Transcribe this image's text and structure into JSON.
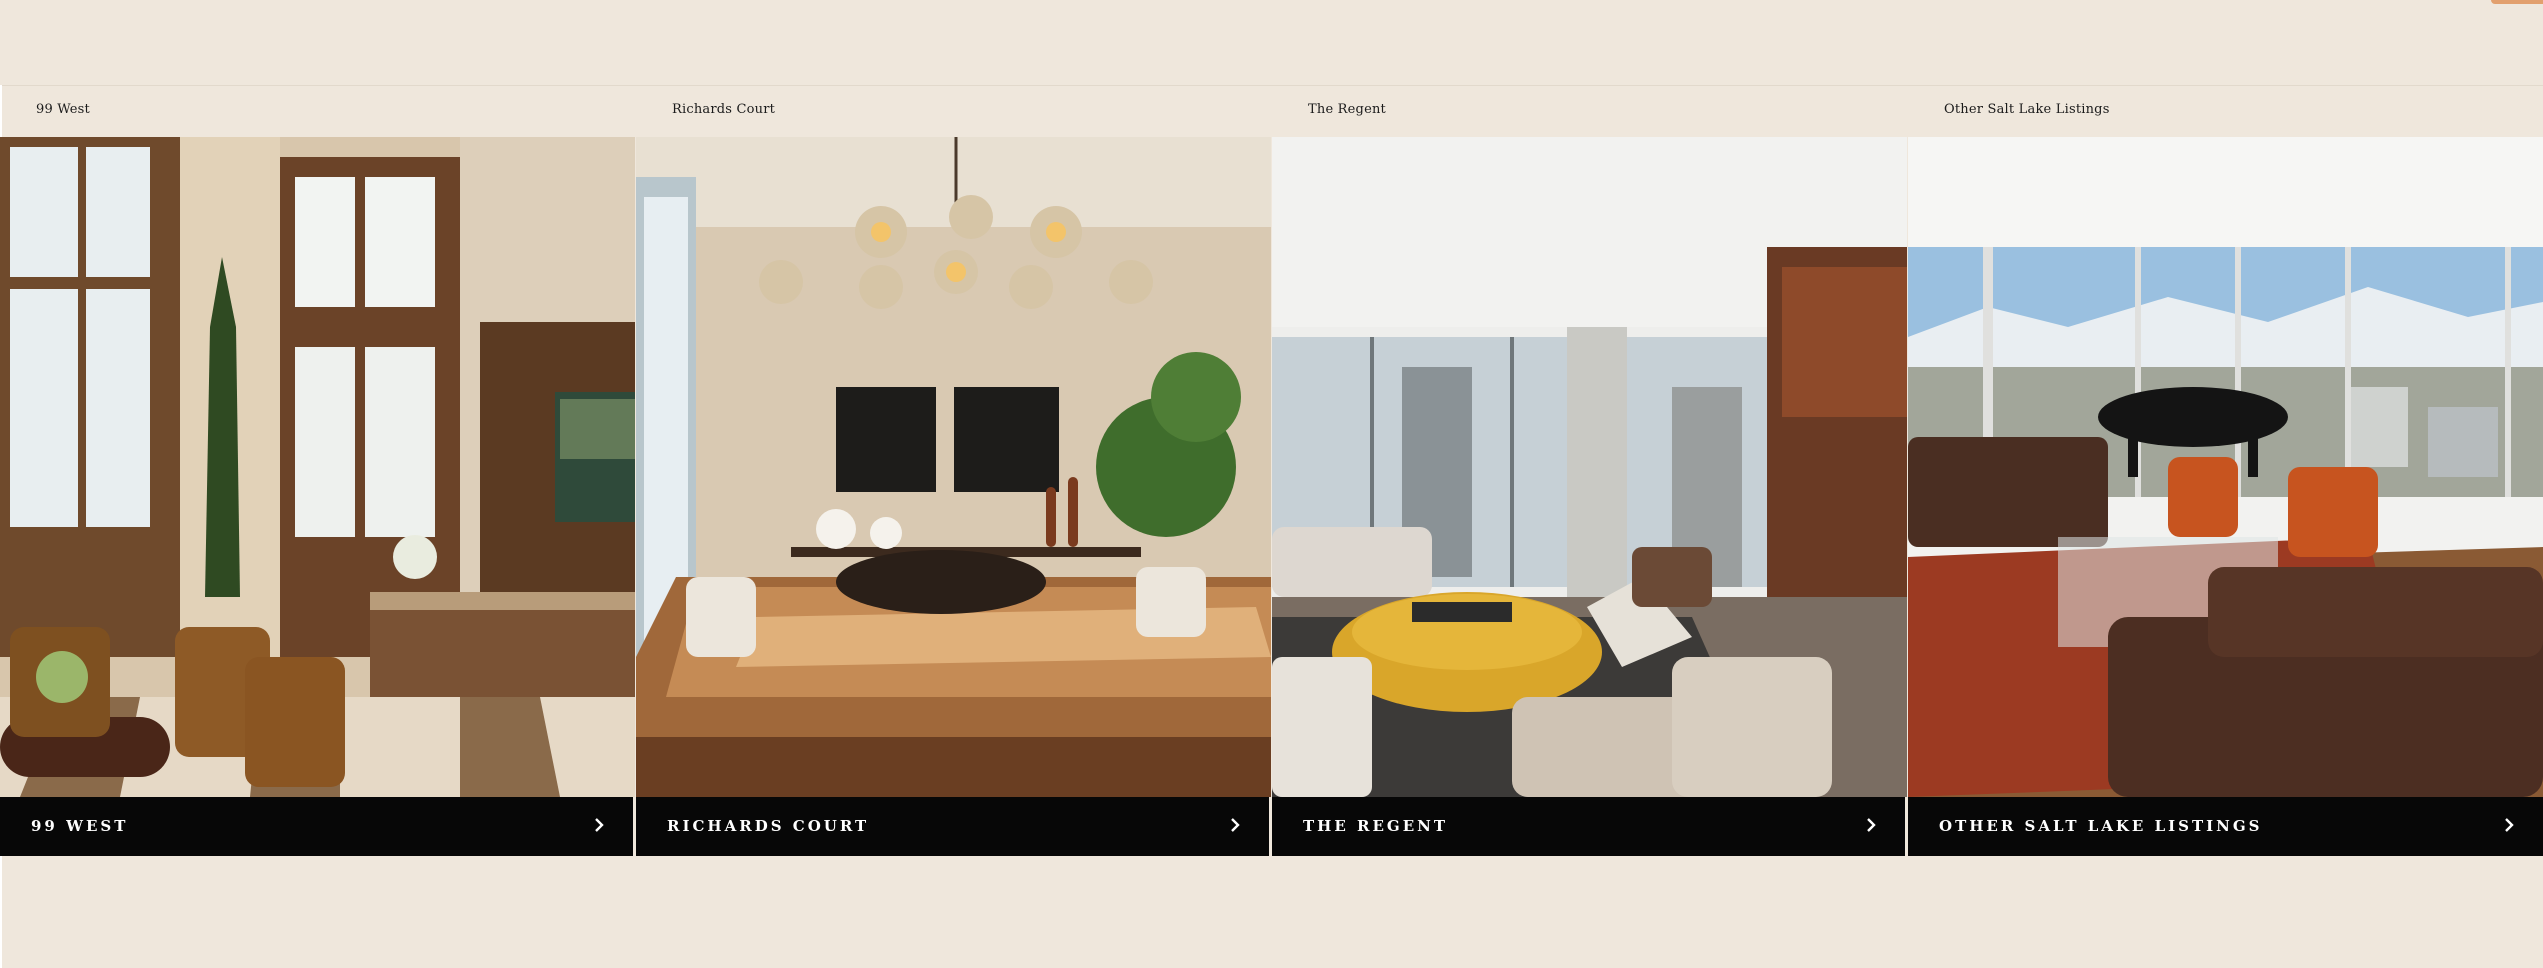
{
  "listings": [
    {
      "title": "99 West",
      "button_label": "99 WEST",
      "image": "lobby with fireplace, armchairs and tall windows"
    },
    {
      "title": "Richards Court",
      "button_label": "RICHARDS COURT",
      "image": "dining room with chandelier and glossy wood table"
    },
    {
      "title": "The Regent",
      "button_label": "THE REGENT",
      "image": "living room with yellow tufted ottoman and city view"
    },
    {
      "title": "Other Salt Lake Listings",
      "button_label": "OTHER SALT LAKE LISTINGS",
      "image": "living room with grand piano and mountain view"
    }
  ],
  "icons": {
    "chevron": "chevron-right-icon"
  },
  "colors": {
    "background": "#efe7dc",
    "bar": "#070707",
    "bar_text": "#ffffff",
    "accent": "#e2a06e"
  }
}
